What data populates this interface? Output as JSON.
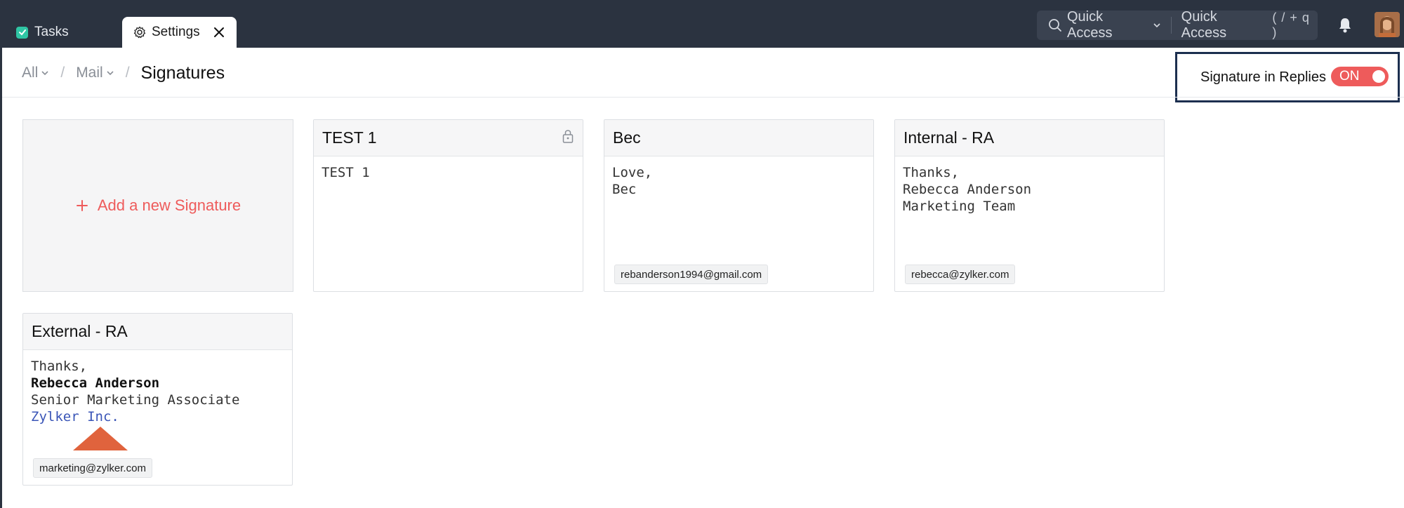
{
  "tabs": [
    {
      "label": "Tasks"
    },
    {
      "label": "Settings"
    }
  ],
  "quick_access": {
    "label": "Quick Access",
    "secondary_label": "Quick Access",
    "shortcut": "( / + q )"
  },
  "breadcrumb": {
    "all": "All",
    "mail": "Mail",
    "separator": "/",
    "current": "Signatures"
  },
  "signature_in_replies": {
    "label": "Signature in Replies",
    "state": "ON"
  },
  "add_signature": {
    "label": "Add a new Signature"
  },
  "signatures": [
    {
      "title": "TEST 1",
      "lines": [
        "TEST 1"
      ],
      "locked": true,
      "email": ""
    },
    {
      "title": "Bec",
      "lines": [
        "Love,",
        "Bec"
      ],
      "email": "rebanderson1994@gmail.com"
    },
    {
      "title": "Internal - RA",
      "lines": [
        "Thanks,",
        "Rebecca Anderson",
        "Marketing Team"
      ],
      "email": "rebecca@zylker.com"
    },
    {
      "title": "External - RA",
      "lines": [
        "Thanks,",
        "Rebecca Anderson",
        "Senior Marketing Associate",
        "Zylker Inc."
      ],
      "email": "marketing@zylker.com"
    }
  ],
  "colors": {
    "topbar": "#2b3340",
    "accent": "#ee5b5b",
    "tasks_icon": "#2fc5a4",
    "focus_border": "#1c2f4f",
    "link_blue": "#3a55b7",
    "logo_orange": "#e0633d"
  },
  "icons": [
    "check-icon",
    "gear-icon",
    "close-icon",
    "search-icon",
    "chevron-down-icon",
    "bell-icon",
    "lock-icon",
    "plus-icon"
  ]
}
